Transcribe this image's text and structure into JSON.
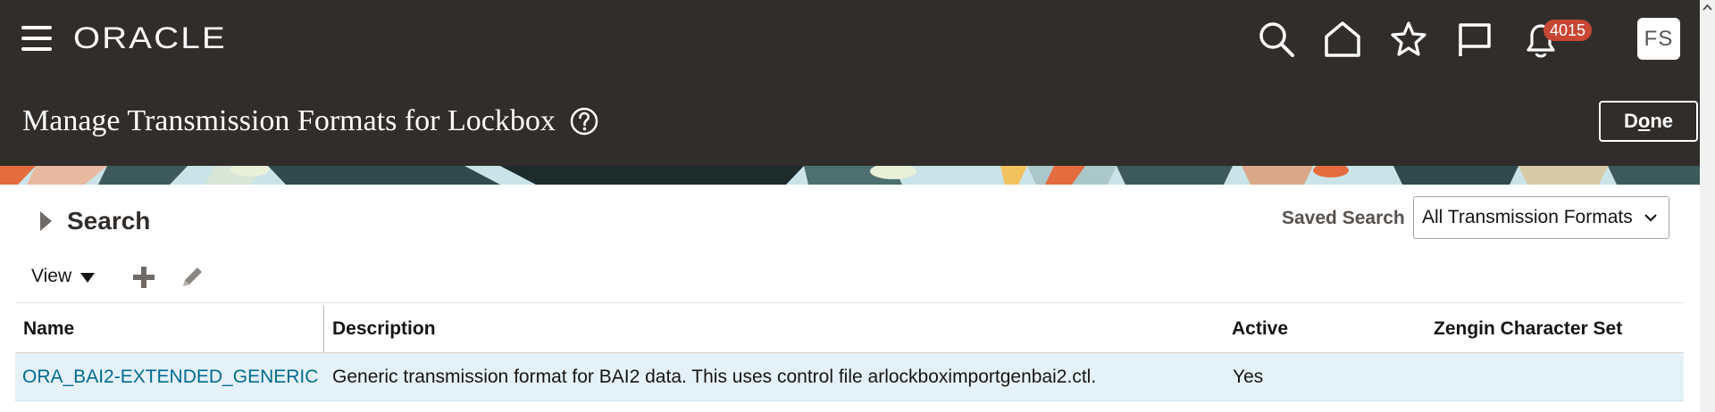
{
  "header": {
    "logo_text": "ORACLE",
    "notifications_count": "4015",
    "user_initials": "FS",
    "icons": [
      "hamburger-icon",
      "search-icon",
      "home-icon",
      "star-icon",
      "flag-icon",
      "bell-icon"
    ]
  },
  "page": {
    "title": "Manage Transmission Formats for Lockbox",
    "done_label": "Done",
    "done_mnemonic_index": 1
  },
  "search": {
    "label": "Search",
    "saved_search_label": "Saved Search",
    "saved_search_value": "All Transmission Formats"
  },
  "toolbar": {
    "view_label": "View"
  },
  "table": {
    "columns": [
      "Name",
      "Description",
      "Active",
      "Zengin Character Set"
    ],
    "rows": [
      {
        "name": "ORA_BAI2-EXTENDED_GENERIC",
        "description": "Generic transmission format for BAI2 data. This uses control file arlockboximportgenbai2.ctl.",
        "active": "Yes",
        "zengin": ""
      }
    ]
  },
  "colors": {
    "header_bg": "#312d2a",
    "badge": "#c74634",
    "link": "#006b8f",
    "selected_row": "#e4f1f9"
  }
}
